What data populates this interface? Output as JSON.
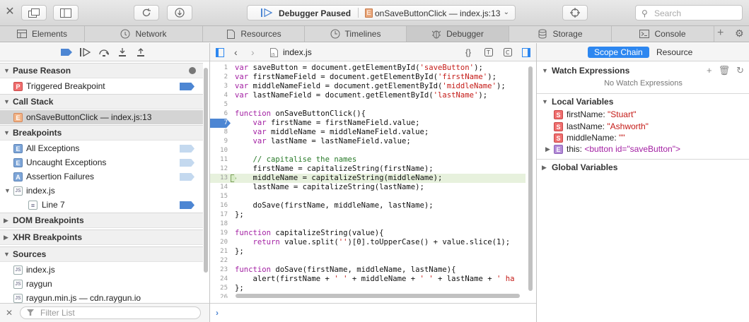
{
  "toolbar": {
    "status": "Debugger Paused",
    "function_badge": "E",
    "function_location": "onSaveButtonClick — index.js:13",
    "search_placeholder": "Search"
  },
  "tabs": [
    {
      "label": "Elements",
      "icon": "elements-icon"
    },
    {
      "label": "Network",
      "icon": "network-icon"
    },
    {
      "label": "Resources",
      "icon": "resources-icon"
    },
    {
      "label": "Timelines",
      "icon": "timelines-icon"
    },
    {
      "label": "Debugger",
      "icon": "debugger-icon",
      "active": true
    },
    {
      "label": "Storage",
      "icon": "storage-icon"
    },
    {
      "label": "Console",
      "icon": "console-icon"
    }
  ],
  "sidebar": {
    "pause_reason": {
      "title": "Pause Reason",
      "item": "Triggered Breakpoint",
      "badge": "P"
    },
    "call_stack": {
      "title": "Call Stack",
      "item": "onSaveButtonClick — index.js:13",
      "badge": "E"
    },
    "breakpoints": {
      "title": "Breakpoints",
      "items": [
        {
          "label": "All Exceptions",
          "badge": "E"
        },
        {
          "label": "Uncaught Exceptions",
          "badge": "E"
        },
        {
          "label": "Assertion Failures",
          "badge": "A"
        },
        {
          "label": "index.js",
          "badge": "JS"
        },
        {
          "label": "Line 7",
          "badge": "≡"
        }
      ]
    },
    "dom_breakpoints": "DOM Breakpoints",
    "xhr_breakpoints": "XHR Breakpoints",
    "sources": {
      "title": "Sources",
      "items": [
        "index.js",
        "raygun",
        "raygun.min.js — cdn.raygun.io"
      ]
    },
    "filter_placeholder": "Filter List"
  },
  "editor": {
    "file_name": "index.js",
    "breakpoint_line": 7,
    "execution_line": 13,
    "lines": [
      {
        "n": "1",
        "html": "<span class=\"kw\">var</span> saveButton = document.getElementById(<span class=\"str\">'saveButton'</span>);"
      },
      {
        "n": "2",
        "html": "<span class=\"kw\">var</span> firstNameField = document.getElementById(<span class=\"str\">'firstName'</span>);"
      },
      {
        "n": "3",
        "html": "<span class=\"kw\">var</span> middleNameField = document.getElementById(<span class=\"str\">'middleName'</span>);"
      },
      {
        "n": "4",
        "html": "<span class=\"kw\">var</span> lastNameField = document.getElementById(<span class=\"str\">'lastName'</span>);"
      },
      {
        "n": "5",
        "html": ""
      },
      {
        "n": "6",
        "html": "<span class=\"kw\">function</span> onSaveButtonClick(){"
      },
      {
        "n": "7",
        "html": "    <span class=\"kw\">var</span> firstName = firstNameField.value;"
      },
      {
        "n": "8",
        "html": "    <span class=\"kw\">var</span> middleName = middleNameField.value;"
      },
      {
        "n": "9",
        "html": "    <span class=\"kw\">var</span> lastName = lastNameField.value;"
      },
      {
        "n": "10",
        "html": ""
      },
      {
        "n": "11",
        "html": "    <span class=\"cm\">// capitalise the names</span>"
      },
      {
        "n": "12",
        "html": "    firstName = capitalizeString(firstName);"
      },
      {
        "n": "13",
        "html": "    middleName = capitalizeString(middleName);"
      },
      {
        "n": "14",
        "html": "    lastName = capitalizeString(lastName);"
      },
      {
        "n": "15",
        "html": ""
      },
      {
        "n": "16",
        "html": "    doSave(firstName, middleName, lastName);"
      },
      {
        "n": "17",
        "html": "};"
      },
      {
        "n": "18",
        "html": ""
      },
      {
        "n": "19",
        "html": "<span class=\"kw\">function</span> capitalizeString(value){"
      },
      {
        "n": "20",
        "html": "    <span class=\"kw\">return</span> value.split(<span class=\"str\">''</span>)[0].toUpperCase() + value.slice(1);"
      },
      {
        "n": "21",
        "html": "};"
      },
      {
        "n": "22",
        "html": ""
      },
      {
        "n": "23",
        "html": "<span class=\"kw\">function</span> doSave(firstName, middleName, lastName){"
      },
      {
        "n": "24",
        "html": "    alert(firstName + <span class=\"str\">' '</span> + middleName + <span class=\"str\">' '</span> + lastName + <span class=\"str\">' ha</span>"
      },
      {
        "n": "25",
        "html": "};"
      },
      {
        "n": "26",
        "html": ""
      }
    ]
  },
  "details": {
    "tabs": [
      "Scope Chain",
      "Resource"
    ],
    "watch_title": "Watch Expressions",
    "no_watch": "No Watch Expressions",
    "local_title": "Local Variables",
    "locals": [
      {
        "name": "firstName:",
        "value": "\"Stuart\"",
        "badge": "S"
      },
      {
        "name": "lastName:",
        "value": "\"Ashworth\"",
        "badge": "S"
      },
      {
        "name": "middleName:",
        "value": "\"\"",
        "badge": "S"
      }
    ],
    "this_var": {
      "name": "this:",
      "value": "<button id=\"saveButton\">",
      "badge": "E"
    },
    "global_title": "Global Variables"
  }
}
